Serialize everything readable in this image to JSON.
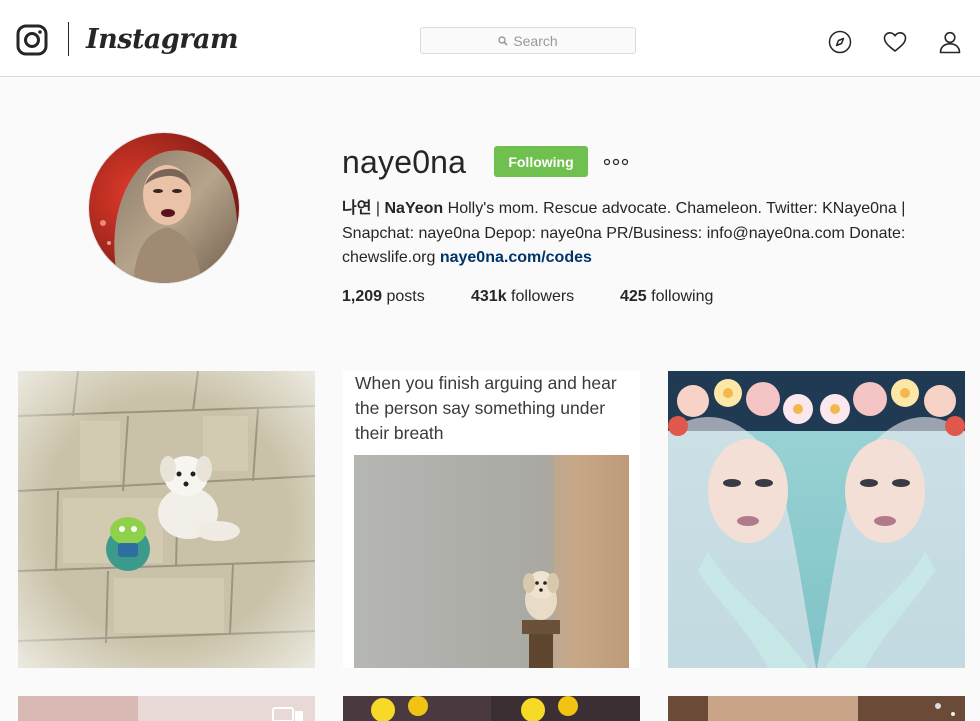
{
  "header": {
    "brand": "Instagram",
    "search": {
      "placeholder": "Search"
    },
    "icons": [
      "instagram-logo-icon",
      "compass-icon",
      "heart-icon",
      "person-icon",
      "search-icon"
    ]
  },
  "profile": {
    "username": "naye0na",
    "follow_button": "Following",
    "bio": {
      "name_korean": "나연",
      "sep": " | ",
      "name": "NaYeon",
      "text": " Holly's mom. Rescue advocate. Chameleon. Twitter: KNaye0na | Snapchat: naye0na Depop: naye0na PR/Business: info@naye0na.com Donate: chewslife.org ",
      "link": "naye0na.com/codes"
    },
    "stats": {
      "posts_count": "1,209",
      "posts_label": " posts",
      "followers_count": "431k",
      "followers_label": " followers",
      "following_count": "425",
      "following_label": " following"
    }
  },
  "posts": {
    "meme_caption": "When you finish arguing and hear the person say something under their breath"
  },
  "colors": {
    "following_button": "#70c050",
    "link": "#003569",
    "border": "#dbdbdb",
    "background": "#fafafa"
  }
}
